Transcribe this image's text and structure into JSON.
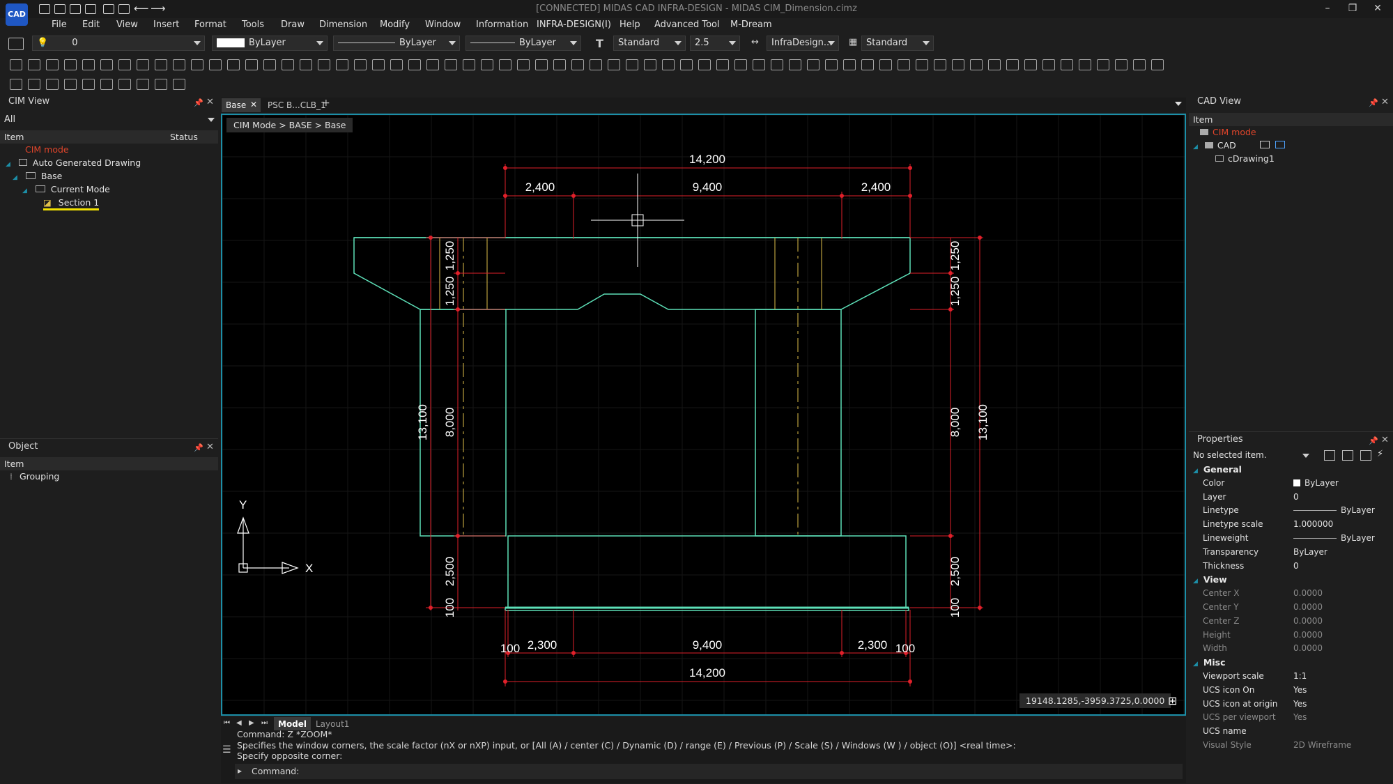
{
  "app": {
    "title": "[CONNECTED] MIDAS CAD INFRA-DESIGN - MIDAS CIM_Dimension.cimz",
    "logo": "CAD"
  },
  "menu": [
    "File",
    "Edit",
    "View",
    "Insert",
    "Format",
    "Tools",
    "Draw",
    "Dimension",
    "Modify",
    "Window",
    "Information",
    "INFRA-DESIGN(I)",
    "Help",
    "Advanced Tool",
    "M-Dream"
  ],
  "properties_toolbar": {
    "layer": "0",
    "color": "ByLayer",
    "linetype": "ByLayer",
    "lineweight": "ByLayer",
    "text_style": "Standard",
    "text_height": "2.5",
    "dim_style": "InfraDesign...",
    "table_style": "Standard"
  },
  "cim_view": {
    "title": "CIM View",
    "filter": "All",
    "columns": [
      "Item",
      "Status"
    ],
    "tree": [
      {
        "label": "CIM mode",
        "level": 0,
        "accent": true
      },
      {
        "label": "Auto Generated Drawing",
        "level": 0
      },
      {
        "label": "Base",
        "level": 1
      },
      {
        "label": "Current Mode",
        "level": 2
      },
      {
        "label": "Section 1",
        "level": 3,
        "selected": true
      }
    ]
  },
  "object_panel": {
    "title": "Object",
    "column": "Item",
    "items": [
      "Grouping"
    ]
  },
  "doc_tabs": [
    "Base",
    "PSC B...CLB_1"
  ],
  "breadcrumb": "CIM Mode > BASE > Base",
  "drawing": {
    "dims_top": {
      "overall": "14,200",
      "left": "2,400",
      "mid": "9,400",
      "right": "2,400"
    },
    "dims_bottom": {
      "overall": "14,200",
      "left": "2,300",
      "mid": "9,400",
      "right": "2,300",
      "edge_left": "100",
      "edge_right": "100"
    },
    "dims_left": {
      "total": "13,100",
      "top1": "1,250",
      "top2": "1,250",
      "mid": "8,000",
      "bot": "2,500",
      "edge": "100"
    },
    "dims_right": {
      "total": "13,100",
      "top1": "1,250",
      "top2": "1,250",
      "mid": "8,000",
      "bot": "2,500",
      "edge": "100"
    },
    "ucs": {
      "x": "X",
      "y": "Y"
    },
    "coords": "19148.1285,-3959.3725,0.0000"
  },
  "layout_tabs": [
    "Model",
    "Layout1"
  ],
  "command": {
    "lines": [
      "Command: Z *ZOOM*",
      "Specifies the window corners, the scale factor (nX or nXP) input, or [All (A) / center (C) / Dynamic (D) / range (E) / Previous (P) / Scale (S) / Windows (W ) / object (O)] <real time>:",
      "Specify opposite corner:"
    ],
    "prompt": "Command:"
  },
  "cad_view": {
    "title": "CAD View",
    "column": "Item",
    "tree": [
      {
        "label": "CIM mode",
        "level": 0,
        "accent": true
      },
      {
        "label": "CAD",
        "level": 0
      },
      {
        "label": "cDrawing1",
        "level": 1
      }
    ]
  },
  "properties": {
    "title": "Properties",
    "selection": "No selected item.",
    "sections": [
      {
        "name": "General",
        "rows": [
          [
            "Color",
            "ByLayer"
          ],
          [
            "Layer",
            "0"
          ],
          [
            "Linetype",
            "ByLayer"
          ],
          [
            "Linetype scale",
            "1.000000"
          ],
          [
            "Lineweight",
            "ByLayer"
          ],
          [
            "Transparency",
            "ByLayer"
          ],
          [
            "Thickness",
            "0"
          ]
        ]
      },
      {
        "name": "View",
        "rows": [
          [
            "Center X",
            "0.0000"
          ],
          [
            "Center Y",
            "0.0000"
          ],
          [
            "Center Z",
            "0.0000"
          ],
          [
            "Height",
            "0.0000"
          ],
          [
            "Width",
            "0.0000"
          ]
        ]
      },
      {
        "name": "Misc",
        "rows": [
          [
            "Viewport scale",
            "1:1"
          ],
          [
            "UCS icon On",
            "Yes"
          ],
          [
            "UCS icon at origin",
            "Yes"
          ],
          [
            "UCS per viewport",
            "Yes"
          ],
          [
            "UCS name",
            ""
          ],
          [
            "Visual Style",
            "2D Wireframe"
          ]
        ]
      }
    ]
  },
  "colors": {
    "accent": "#1c8fa8",
    "cim_mode": "#e0452b",
    "dim": "#e0202a",
    "shape": "#5de0b8",
    "center": "#e0c04a"
  }
}
